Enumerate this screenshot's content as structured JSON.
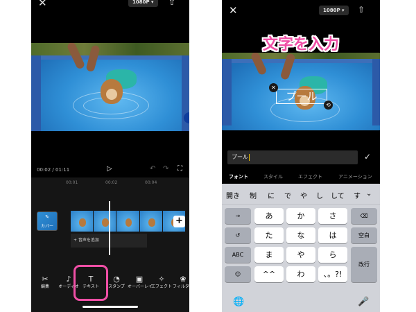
{
  "left_screen": {
    "close_icon": "close-icon",
    "resolution": "1080P ▾",
    "upload_icon": "upload-icon",
    "current_time": "00:02",
    "total_time": "01:11",
    "ruler_ticks": [
      "00:01",
      "00:02",
      "00:04"
    ],
    "cover_label": "カバー",
    "add_audio_label": "+ 音声を追加",
    "toolbar": [
      {
        "icon": "scissors-icon",
        "glyph": "✂",
        "label": "編集"
      },
      {
        "icon": "music-note-icon",
        "glyph": "♪",
        "label": "オーディオ"
      },
      {
        "icon": "text-icon",
        "glyph": "T",
        "label": "テキスト"
      },
      {
        "icon": "sticker-icon",
        "glyph": "◔",
        "label": "スタンプ"
      },
      {
        "icon": "overlay-icon",
        "glyph": "▣",
        "label": "オーバーレイ"
      },
      {
        "icon": "effect-icon",
        "glyph": "✧",
        "label": "エフェクト"
      },
      {
        "icon": "filter-icon",
        "glyph": "❀",
        "label": "フィルター"
      }
    ]
  },
  "right_screen": {
    "close_icon": "close-icon",
    "resolution": "1080P ▾",
    "upload_icon": "upload-icon",
    "callout": "文字を入力",
    "overlay_text": "プール",
    "input_value": "プール",
    "text_tabs": [
      {
        "label": "フォント",
        "active": true
      },
      {
        "label": "スタイル",
        "active": false
      },
      {
        "label": "エフェクト",
        "active": false
      },
      {
        "label": "アニメーション",
        "active": false
      }
    ],
    "candidates": [
      "開き",
      "制",
      "に",
      "で",
      "や",
      "し",
      "して",
      "す"
    ],
    "keyboard": {
      "left_keys": [
        "→",
        "↺",
        "ABC",
        "☺"
      ],
      "kana_keys": [
        "あ",
        "か",
        "さ",
        "た",
        "な",
        "は",
        "ま",
        "や",
        "ら",
        "^^",
        "わ",
        "、。?!"
      ],
      "backspace": "⌫",
      "space": "空白",
      "enter": "改行",
      "globe": "🌐",
      "mic": "🎤"
    }
  }
}
